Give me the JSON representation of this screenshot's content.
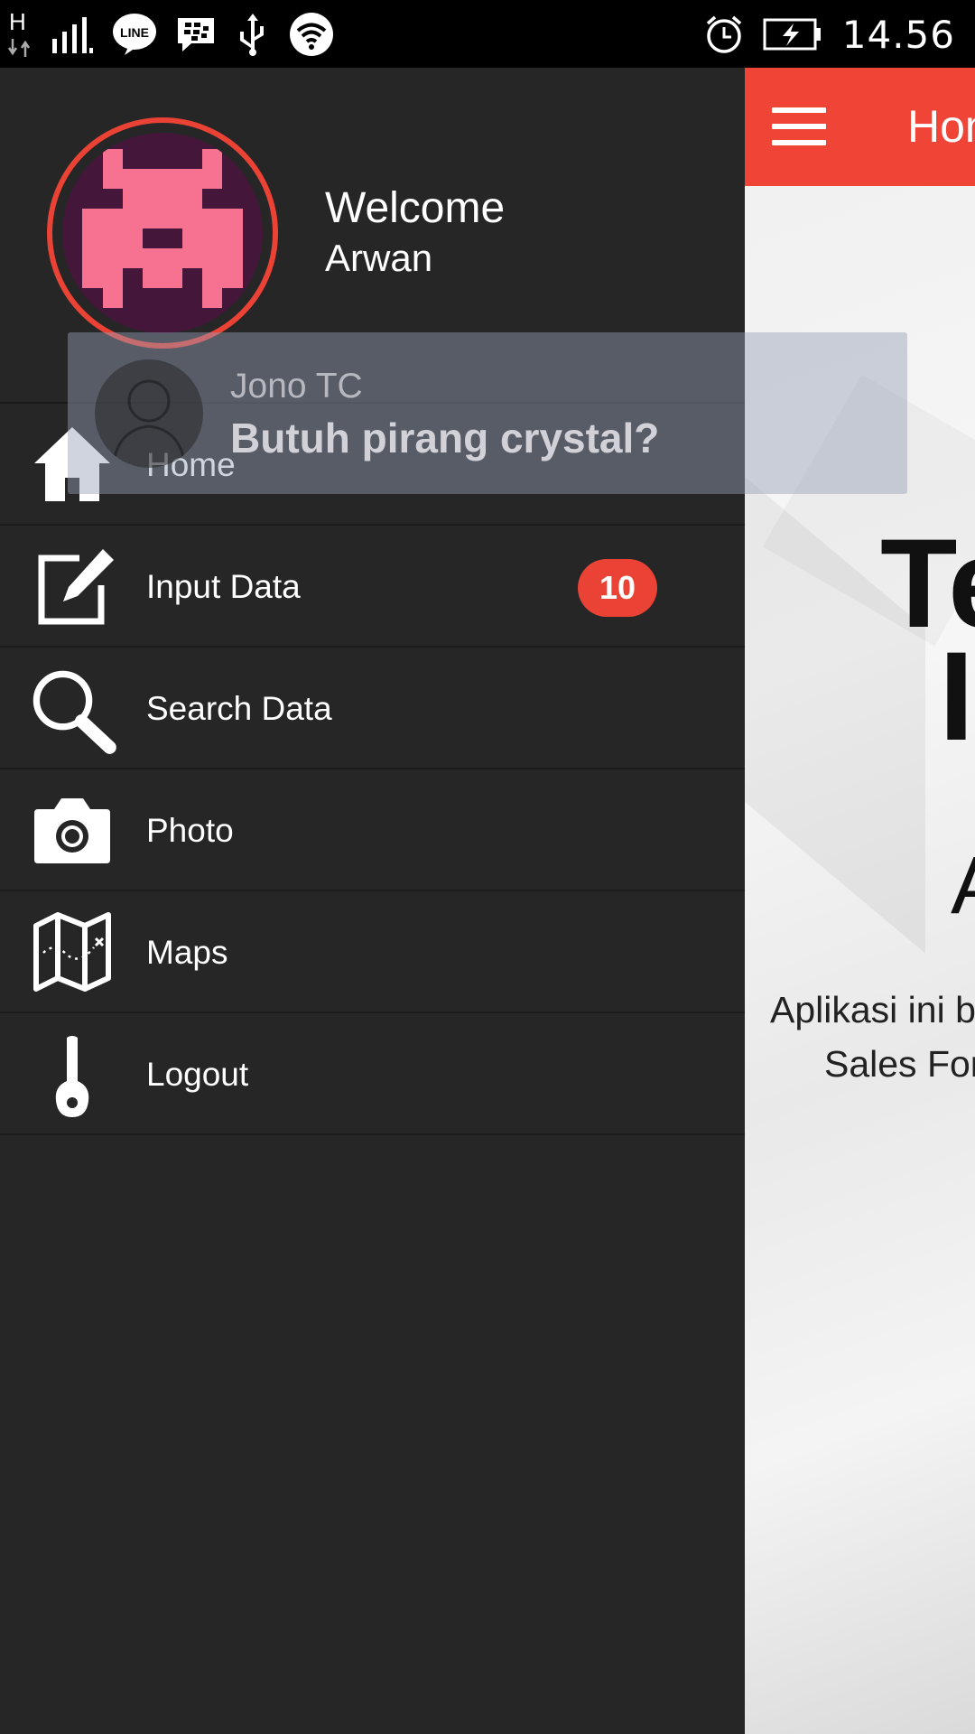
{
  "status_bar": {
    "network_type": "H",
    "time": "14.56",
    "icons": [
      "network-type-icon",
      "signal-icon",
      "line-app-icon",
      "bbm-icon",
      "usb-icon",
      "wifi-icon",
      "alarm-icon",
      "battery-charging-icon"
    ]
  },
  "main_page": {
    "appbar_title": "Hom",
    "hero_line1": "Te",
    "hero_line2": "I",
    "hero_line3": "A",
    "description_line1": "Aplikasi ini b",
    "description_line2": "Sales For",
    "accent_color": "#f04437"
  },
  "drawer": {
    "welcome_text": "Welcome",
    "username": "Arwan",
    "background_color": "#262626",
    "items": [
      {
        "label": "Home",
        "icon": "home-icon"
      },
      {
        "label": "Input Data",
        "icon": "edit-icon",
        "badge": "10"
      },
      {
        "label": "Search Data",
        "icon": "search-icon"
      },
      {
        "label": "Photo",
        "icon": "camera-icon"
      },
      {
        "label": "Maps",
        "icon": "map-icon"
      },
      {
        "label": "Logout",
        "icon": "key-icon"
      }
    ]
  },
  "notification": {
    "sender": "Jono TC",
    "message": "Butuh pirang crystal?"
  }
}
